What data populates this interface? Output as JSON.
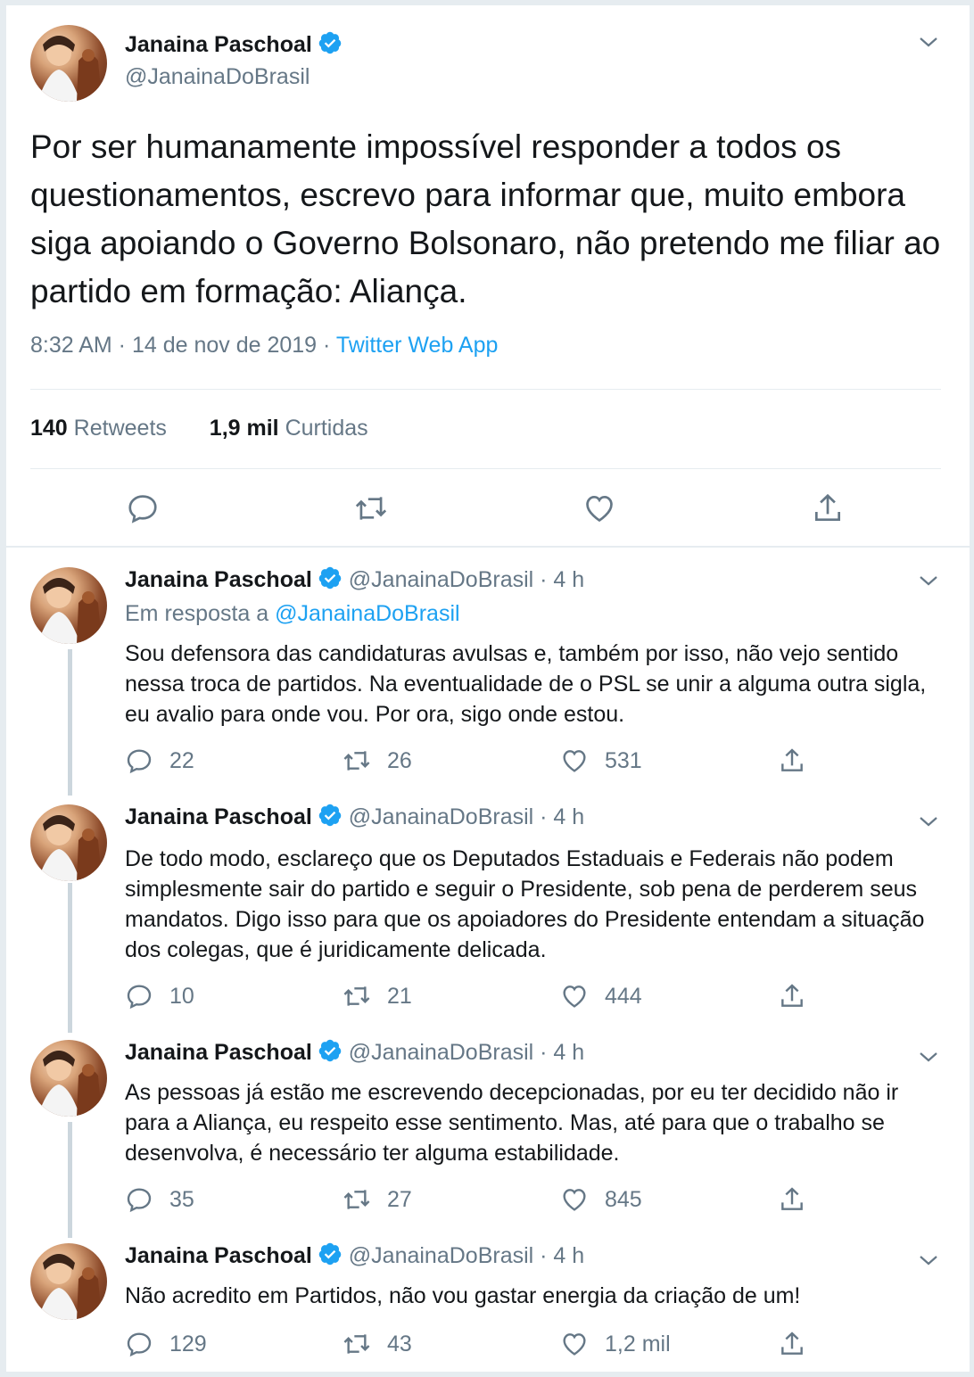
{
  "main": {
    "name": "Janaina Paschoal",
    "handle": "@JanainaDoBrasil",
    "text": "Por ser humanamente impossível responder a todos os questionamentos, escrevo para informar que, muito embora siga apoiando o Governo Bolsonaro, não pretendo me filiar ao partido em formação: Aliança.",
    "time": "8:32 AM · 14 de nov de 2019 · ",
    "source": "Twitter Web App",
    "retweets_count": "140",
    "retweets_label": "Retweets",
    "likes_count": "1,9 mil",
    "likes_label": "Curtidas"
  },
  "replies": [
    {
      "name": "Janaina Paschoal",
      "handle": "@JanainaDoBrasil",
      "time": "· 4 h",
      "in_reply_prefix": "Em resposta a ",
      "in_reply_handle": "@JanainaDoBrasil",
      "text": "Sou defensora das candidaturas avulsas e, também por isso, não vejo sentido nessa troca de partidos. Na eventualidade de o PSL se unir a alguma outra sigla, eu avalio para onde vou. Por ora, sigo onde estou.",
      "replies": "22",
      "retweets": "26",
      "likes": "531"
    },
    {
      "name": "Janaina Paschoal",
      "handle": "@JanainaDoBrasil",
      "time": "· 4 h",
      "text": "De todo modo, esclareço que os Deputados Estaduais e Federais não podem simplesmente sair do partido e seguir o Presidente, sob pena de perderem seus mandatos. Digo isso para que os apoiadores do Presidente entendam a situação dos colegas, que é juridicamente delicada.",
      "replies": "10",
      "retweets": "21",
      "likes": "444"
    },
    {
      "name": "Janaina Paschoal",
      "handle": "@JanainaDoBrasil",
      "time": "· 4 h",
      "text": "As pessoas já estão me escrevendo decepcionadas, por eu  ter decidido não ir para a Aliança, eu respeito esse sentimento. Mas, até para que o trabalho se desenvolva, é necessário ter alguma estabilidade.",
      "replies": "35",
      "retweets": "27",
      "likes": "845"
    },
    {
      "name": "Janaina Paschoal",
      "handle": "@JanainaDoBrasil",
      "time": "· 4 h",
      "text": "Não acredito em Partidos, não vou gastar energia da criação de um!",
      "replies": "129",
      "retweets": "43",
      "likes": "1,2 mil"
    }
  ],
  "colors": {
    "accent": "#1da1f2",
    "muted": "#657786",
    "thread": "#ccd6dd"
  },
  "icons": [
    "chevron-down-icon",
    "verified-badge-icon",
    "reply-icon",
    "retweet-icon",
    "like-icon",
    "share-icon"
  ]
}
